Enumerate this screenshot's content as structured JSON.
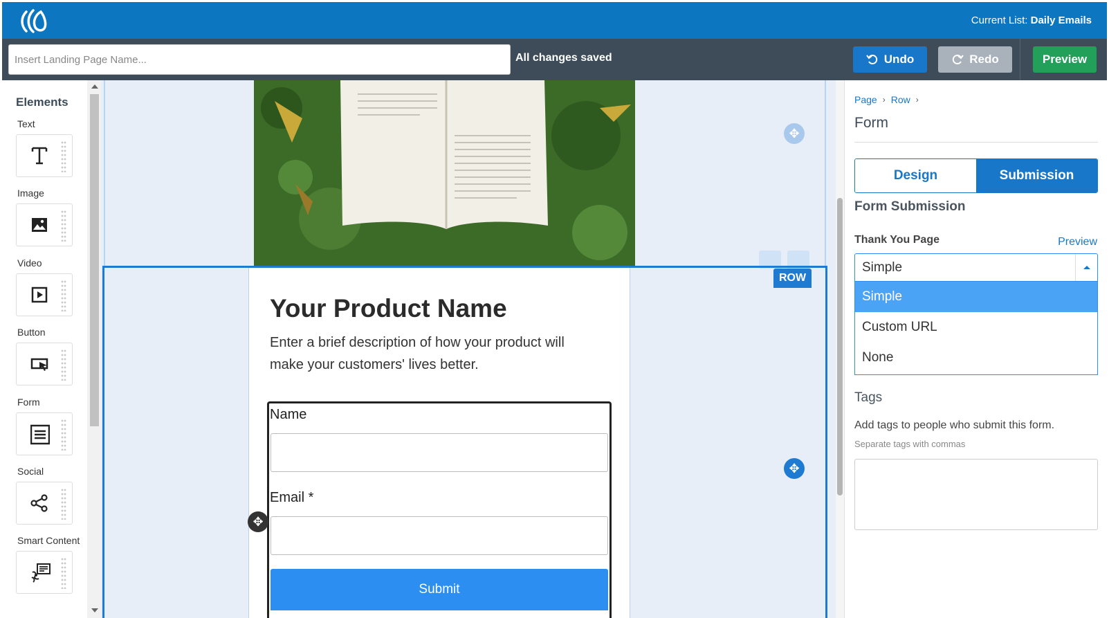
{
  "header": {
    "current_list_label": "Current List:",
    "current_list_value": "Daily Emails"
  },
  "toolbar": {
    "name_placeholder": "Insert Landing Page Name...",
    "status": "All changes saved",
    "undo_label": "Undo",
    "redo_label": "Redo",
    "preview_label": "Preview"
  },
  "sidebar": {
    "title": "Elements",
    "items": [
      {
        "label": "Text",
        "icon": "text-icon"
      },
      {
        "label": "Image",
        "icon": "image-icon"
      },
      {
        "label": "Video",
        "icon": "video-icon"
      },
      {
        "label": "Button",
        "icon": "button-icon"
      },
      {
        "label": "Form",
        "icon": "form-icon"
      },
      {
        "label": "Social",
        "icon": "share-icon"
      },
      {
        "label": "Smart Content",
        "icon": "smart-content-icon"
      }
    ]
  },
  "canvas": {
    "row_tag": "ROW",
    "product_title": "Your Product Name",
    "product_description": "Enter a brief description of how your product will make your customers' lives better.",
    "form": {
      "name_label": "Name",
      "email_label": "Email *",
      "submit_label": "Submit"
    }
  },
  "panel": {
    "breadcrumb": [
      "Page",
      "Row"
    ],
    "title": "Form",
    "tabs": [
      {
        "label": "Design",
        "active": false
      },
      {
        "label": "Submission",
        "active": true
      }
    ],
    "section_title": "Form Submission",
    "thank_you_label": "Thank You Page",
    "thank_you_preview": "Preview",
    "thank_you_selected": "Simple",
    "thank_you_options": [
      "Simple",
      "Custom URL",
      "None"
    ],
    "tags_title": "Tags",
    "tags_help": "Add tags to people who submit this form.",
    "tags_hint": "Separate tags with commas",
    "tags_value": ""
  },
  "colors": {
    "brand_blue": "#0d76c0",
    "toolbar_dark": "#3d4c58",
    "preview_green": "#22a05a",
    "selection_blue": "#1f7bd2",
    "submit_blue": "#2b8ef0"
  }
}
